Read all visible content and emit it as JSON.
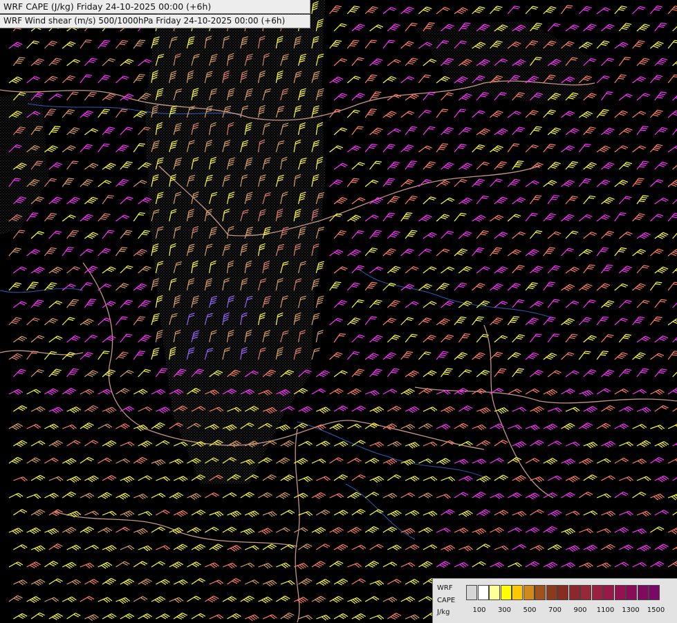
{
  "titles": {
    "line1": "WRF CAPE (J/kg) Friday 24-10-2025 00:00 (+6h)",
    "line2": "WRF Wind shear (m/s) 500/1000hPa Friday 24-10-2025 00:00 (+6h)"
  },
  "legend": {
    "row1": "WRF",
    "row2": "CAPE",
    "row3": "J/kg",
    "tick_labels": [
      "100",
      "300",
      "500",
      "700",
      "900",
      "1100",
      "1300",
      "1500"
    ],
    "swatch_colors": [
      "#d6d6d6",
      "#ffffff",
      "#ffff99",
      "#ffff00",
      "#ffc800",
      "#d08a1a",
      "#a0521e",
      "#8b3a1e",
      "#8a2a20",
      "#8e2630",
      "#962838",
      "#9b2040",
      "#9a1848",
      "#951250",
      "#8a0c58",
      "#800a60",
      "#7a0868"
    ]
  },
  "colors": {
    "background": "#000000",
    "barb_yellow": "#ffff33",
    "barb_magenta": "#ff33ff",
    "barb_salmon": "#ff8066",
    "barb_tan": "#d9a066",
    "barb_rose": "#e08070",
    "barb_violet": "#9966ff",
    "borders": "#e8b0a0",
    "rivers": "#3366cc",
    "cape_stipple": "#555555"
  },
  "map": {
    "symbol": "wind-barb",
    "grid_columns": 38,
    "grid_rows": 36
  }
}
